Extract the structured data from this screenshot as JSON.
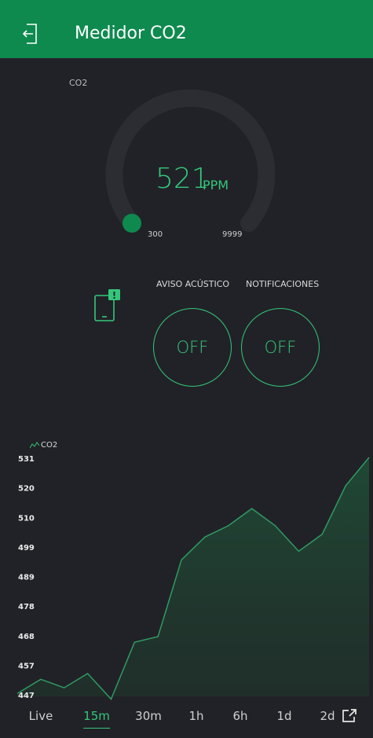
{
  "header": {
    "title": "Medidor CO2",
    "back_icon": "exit-icon"
  },
  "gauge": {
    "label": "CO2",
    "value": "521",
    "unit": "PPM",
    "min": "300",
    "max": "9999",
    "value_num": 521,
    "accent": "#34c77b"
  },
  "notifications_icon": "phone-notification-icon",
  "buttons": [
    {
      "label": "AVISO ACÚSTICO",
      "state": "OFF"
    },
    {
      "label": "NOTIFICACIONES",
      "state": "OFF"
    }
  ],
  "chart_data": {
    "type": "area",
    "legend": "CO2",
    "y_ticks": [
      "531",
      "520",
      "510",
      "499",
      "489",
      "478",
      "468",
      "457",
      "447"
    ],
    "ylim": [
      447,
      531
    ],
    "values": [
      448,
      453,
      450,
      455,
      446,
      466,
      468,
      495,
      503,
      507,
      513,
      507,
      498,
      504,
      521,
      531
    ],
    "color": "#34c77b"
  },
  "time_ranges": [
    "Live",
    "15m",
    "30m",
    "1h",
    "6h",
    "1d",
    "2d"
  ],
  "active_range": "15m",
  "expand_icon": "expand-icon"
}
